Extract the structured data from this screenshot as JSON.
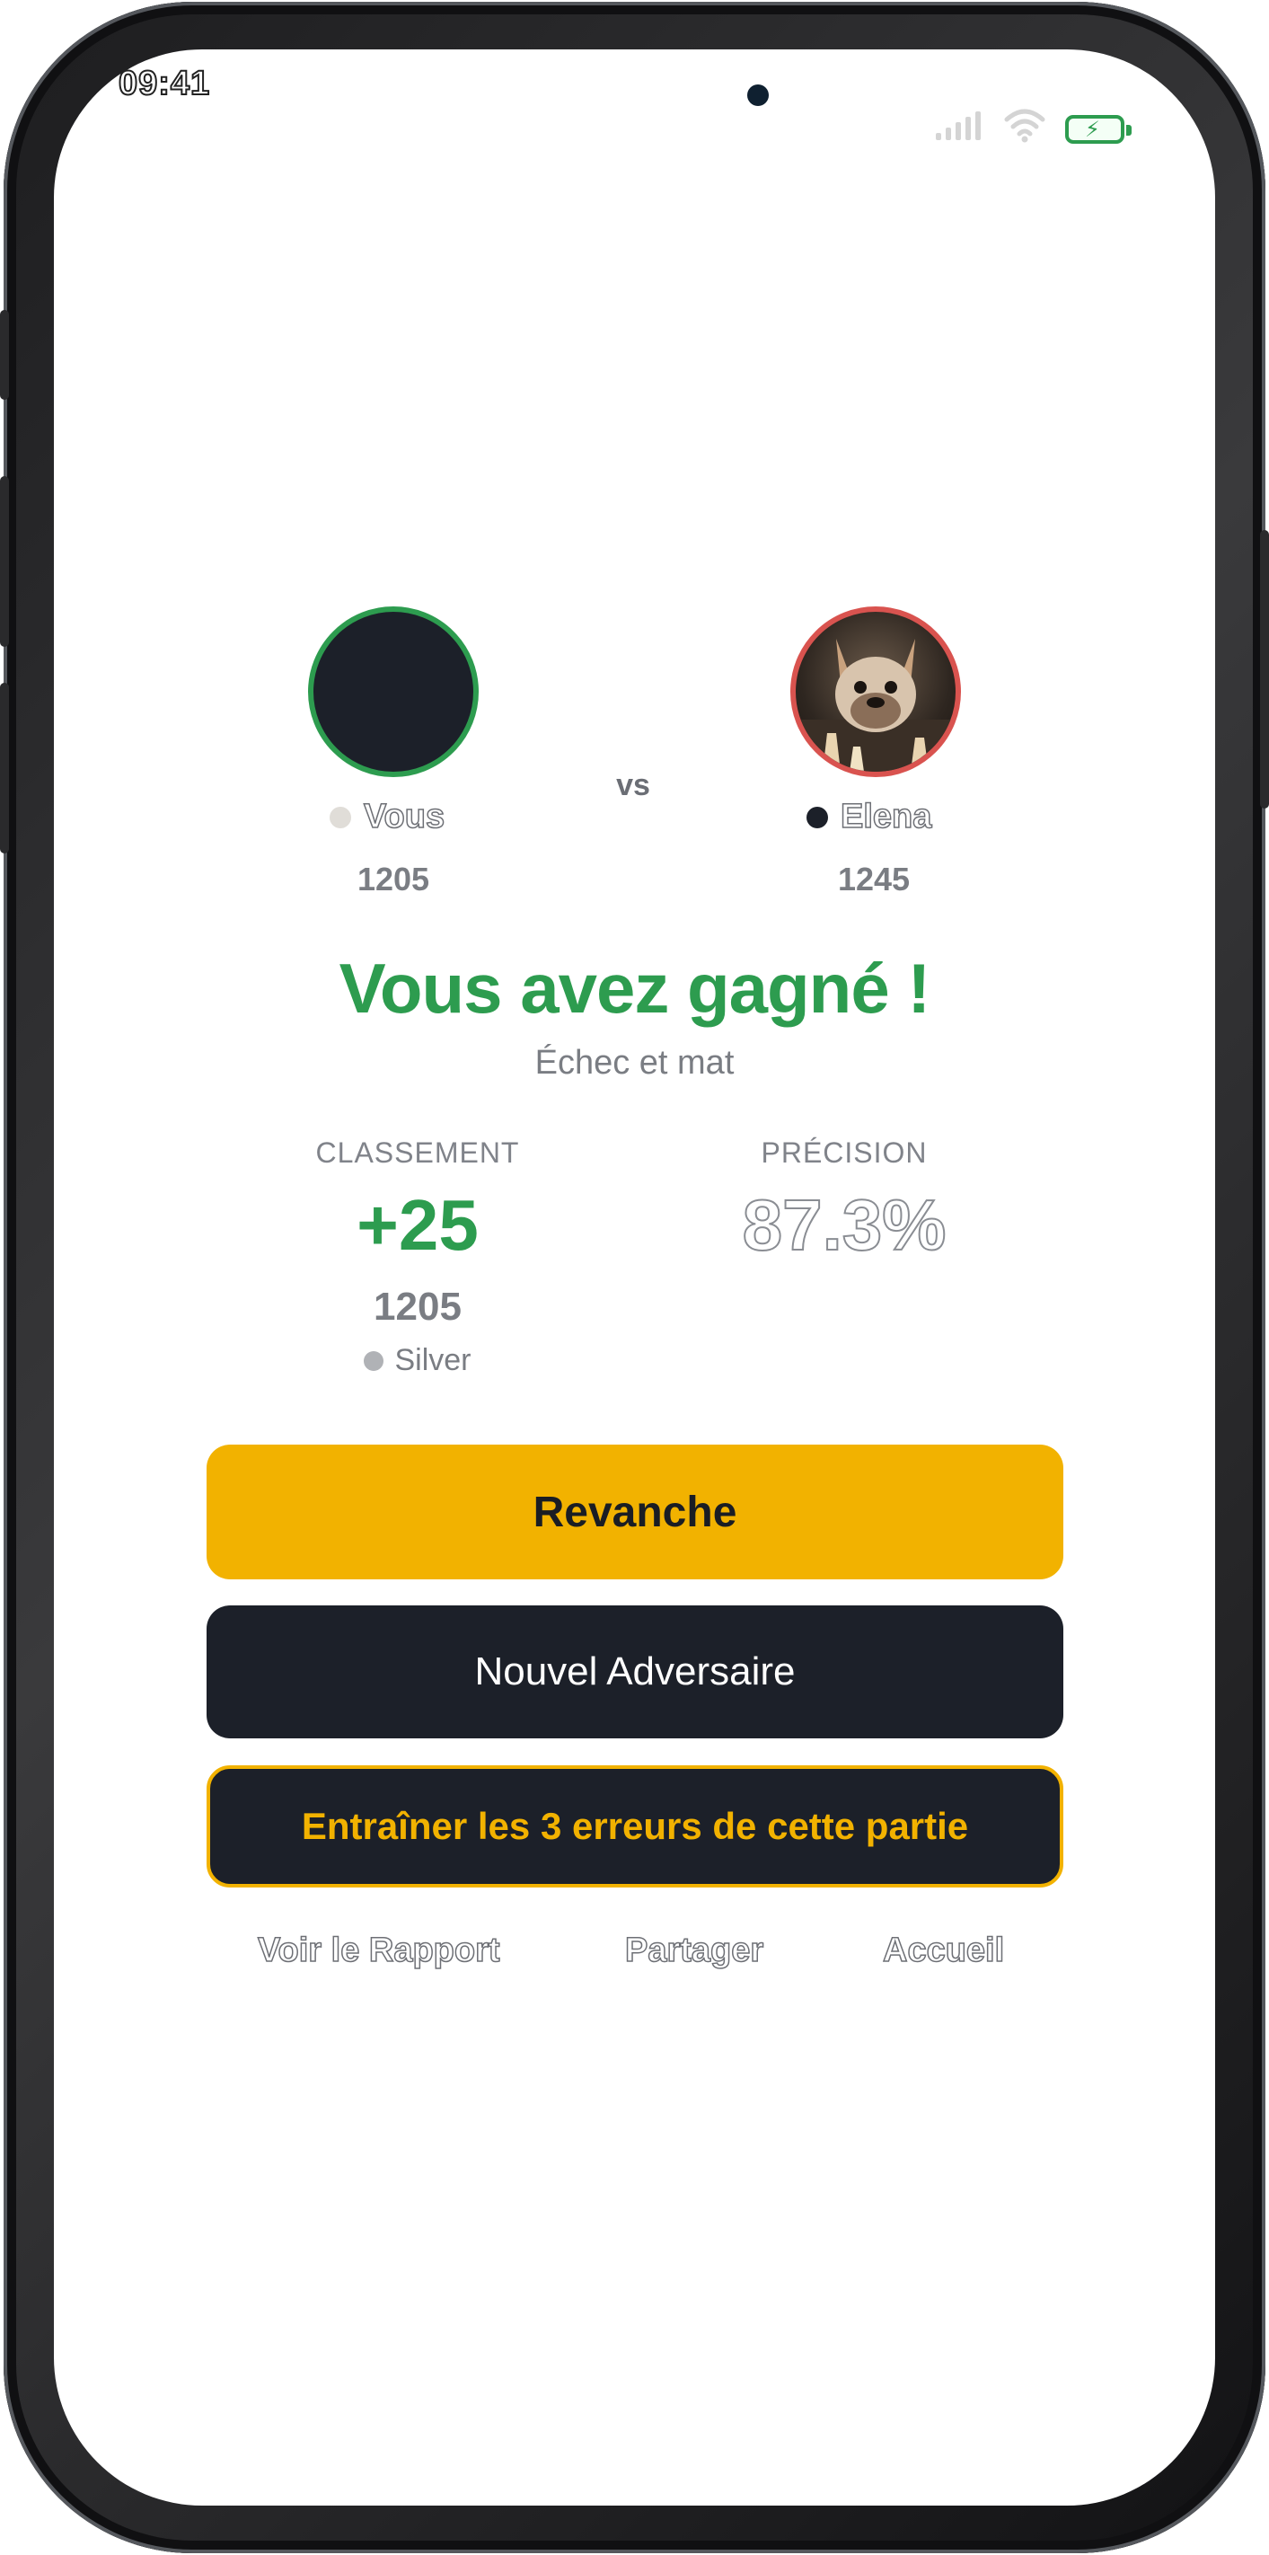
{
  "status_bar": {
    "time": "09:41"
  },
  "match": {
    "vs_label": "vs",
    "player": {
      "name": "Vous",
      "rating": "1205",
      "dot_color": "#e0ddd8"
    },
    "opponent": {
      "name": "Elena",
      "rating": "1245",
      "dot_color": "#1c2029",
      "avatar": "french-bulldog-chess-avatar"
    }
  },
  "result": {
    "title": "Vous avez gagné !",
    "subtitle": "Échec et mat"
  },
  "stats": {
    "ranking_label": "CLASSEMENT",
    "ranking_delta": "+25",
    "rating": "1205",
    "tier": "Silver",
    "precision_label": "PRÉCISION",
    "precision_value": "87.3%"
  },
  "actions": {
    "rematch": "Revanche",
    "new_opponent": "Nouvel Adversaire",
    "train_errors": "Entraîner les 3 erreurs de cette partie"
  },
  "links": {
    "report": "Voir le Rapport",
    "share": "Partager",
    "home": "Accueil"
  },
  "colors": {
    "win_green": "#2d9c4f",
    "accent_yellow": "#f2b200",
    "dark": "#1c2029",
    "loss_red": "#d9534f"
  }
}
